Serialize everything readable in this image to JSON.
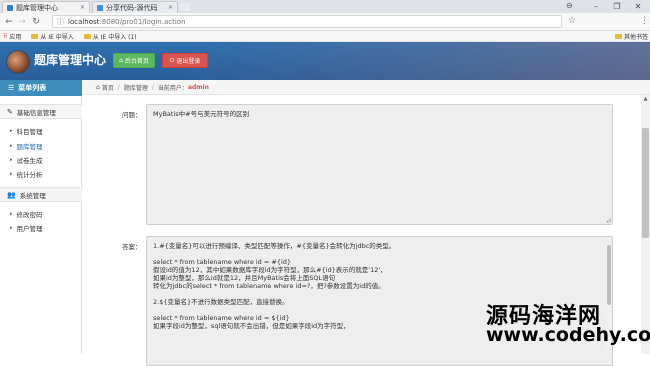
{
  "browser": {
    "tabs": [
      {
        "title": "题库管理中心",
        "active": true
      },
      {
        "title": "分享代码-源代码",
        "active": false
      }
    ],
    "url_host": "localhost",
    "url_rest": ":8080/pro01/login.action",
    "bookmarks": [
      "应用",
      "从 IE 中导入",
      "从 IE 中导入 (1)"
    ],
    "other_bookmarks": "其他书签",
    "window_controls": [
      "–",
      "❐",
      "✕"
    ]
  },
  "header": {
    "app_title": "题库管理中心",
    "home_button": "后台首页",
    "logout_button": "退出登录"
  },
  "sidebar": {
    "menu_title": "菜单列表",
    "sections": [
      {
        "title": "基础信息管理",
        "icon": "edit-icon",
        "items": [
          "科目管理",
          "题库管理",
          "试卷生成",
          "统计分析"
        ]
      },
      {
        "title": "系统管理",
        "icon": "users-icon",
        "items": [
          "修改密码",
          "用户管理"
        ]
      }
    ],
    "active_item": "题库管理"
  },
  "breadcrumb": {
    "home": "首页",
    "current": "题库管理",
    "user_prefix": "当前用户：",
    "user": "admin"
  },
  "form": {
    "question_label": "问题：",
    "question_value": "MyBatis中#号与美元符号的区别",
    "answer_label": "答案：",
    "answer_lines": [
      "1.#{变量名}可以进行预编译、类型匹配等操作，#{变量名}会转化为jdbc的类型。",
      "",
      "select * from tablename where id = #{id}",
      "假设id的值为12，其中如果数据库字段id为字符型，那么#{id}表示的就是'12'，",
      "如果id为整型，那么id就是12，并且MyBatis会将上面SQL语句",
      "转化为jdbc的select * from tablename where id=?，把?参数设置为id的值。",
      "",
      "2.${变量名}不进行数据类型匹配，直接替换。",
      "",
      "select * from tablename where id = ${id}",
      "如果字段id为整型，sql语句就不会出错，但是如果字段id为字符型，"
    ]
  },
  "watermark": {
    "line1": "源码海洋网",
    "line2": "www.codehy.com"
  },
  "colors": {
    "header_blue": "#2f6fb0",
    "menu_head": "#3c8dbc",
    "home_green": "#5cb85c",
    "logout_red": "#d9534f",
    "active_link": "#2a6fb5"
  }
}
